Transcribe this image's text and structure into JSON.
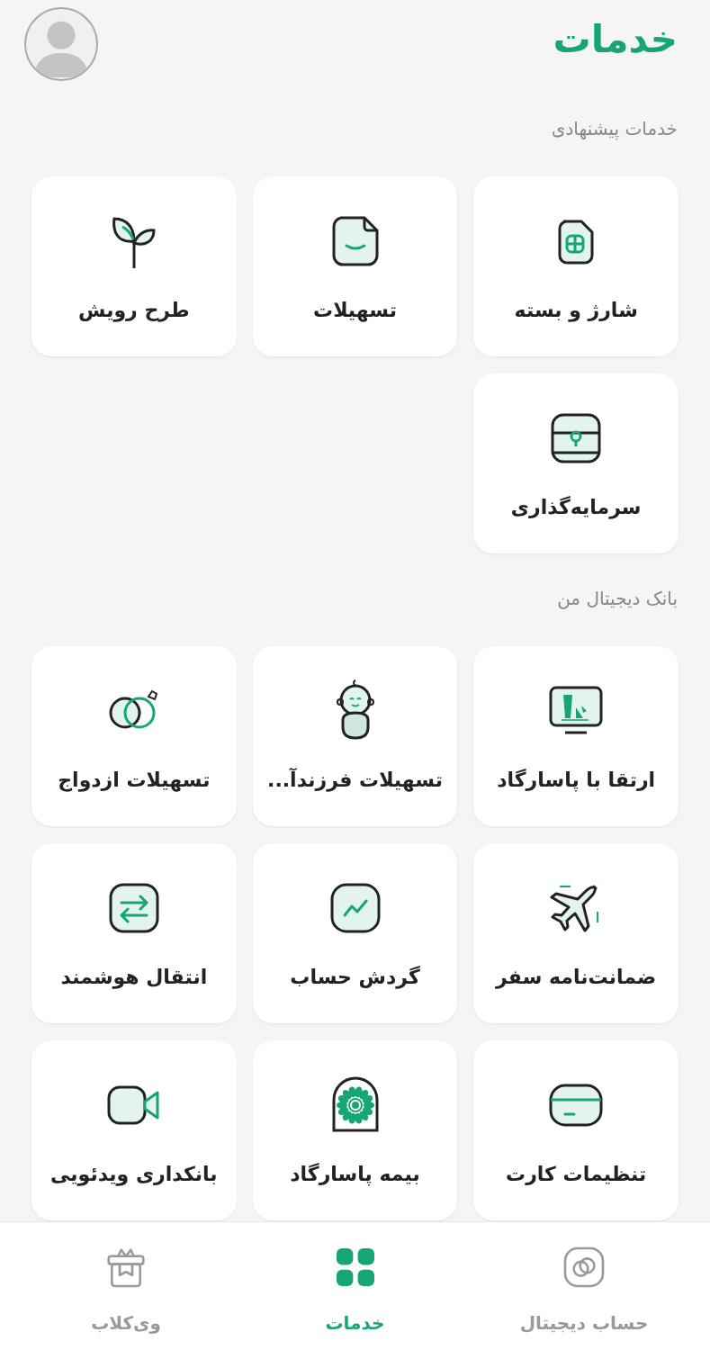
{
  "header": {
    "title": "خدمات"
  },
  "sections": [
    {
      "title": "خدمات پیشنهادی",
      "items": [
        {
          "label": "شارژ و بسته"
        },
        {
          "label": "تسهیلات"
        },
        {
          "label": "طرح رویش"
        },
        {
          "label": "سرمایه‌گذاری"
        }
      ]
    },
    {
      "title": "بانک دیجیتال من",
      "items": [
        {
          "label": "ارتقا با پاسارگاد"
        },
        {
          "label": "تسهیلات فرزندآ..."
        },
        {
          "label": "تسهیلات ازدواج"
        },
        {
          "label": "ضمانت‌نامه سفر"
        },
        {
          "label": "گردش حساب"
        },
        {
          "label": "انتقال هوشمند"
        },
        {
          "label": "تنظیمات کارت"
        },
        {
          "label": "بیمه پاسارگاد"
        },
        {
          "label": "بانکداری ویدئویی"
        }
      ]
    }
  ],
  "bottom_nav": [
    {
      "label": "حساب دیجیتال",
      "selected": false
    },
    {
      "label": "خدمات",
      "selected": true
    },
    {
      "label": "وی‌کلاب",
      "selected": false
    }
  ]
}
